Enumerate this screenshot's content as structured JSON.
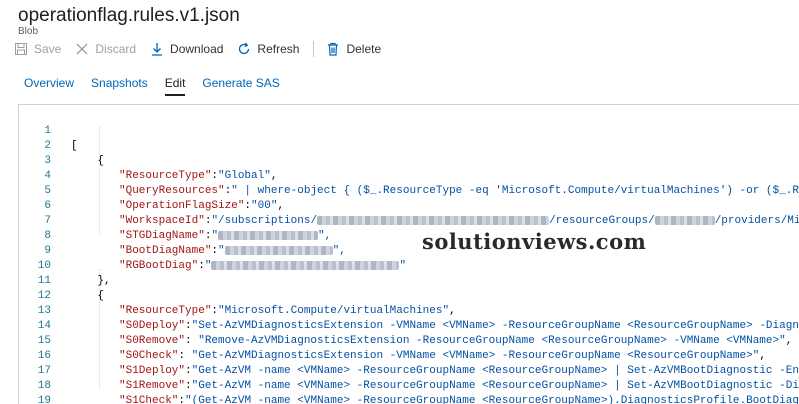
{
  "header": {
    "title": "operationflag.rules.v1.json",
    "subtitle": "Blob"
  },
  "toolbar": {
    "save_label": "Save",
    "discard_label": "Discard",
    "download_label": "Download",
    "refresh_label": "Refresh",
    "delete_label": "Delete"
  },
  "tabs": [
    {
      "label": "Overview"
    },
    {
      "label": "Snapshots"
    },
    {
      "label": "Edit"
    },
    {
      "label": "Generate SAS"
    }
  ],
  "editor": {
    "lines": [
      {
        "num": "1",
        "text": "["
      },
      {
        "num": "2",
        "text": "    {"
      },
      {
        "num": "3",
        "key": "\"ResourceType\"",
        "sep": ":",
        "val": "\"Global\"",
        "tail": ","
      },
      {
        "num": "4",
        "key": "\"QueryResources\"",
        "sep": ":",
        "val": "\" | where-object { ($_.ResourceType -eq 'Microsoft.Compute/virtualMachines') -or ($_.Resourc"
      },
      {
        "num": "5",
        "key": "\"OperationFlagSize\"",
        "sep": ":",
        "val": "\"00\"",
        "tail": ","
      },
      {
        "num": "6",
        "key": "\"WorkspaceId\"",
        "sep": ":",
        "val": "\"/subscriptions/",
        "val2": "/resourceGroups/",
        "val3": "/providers/Microso"
      },
      {
        "num": "7",
        "key": "\"STGDiagName\"",
        "sep": ":",
        "val": "\"",
        "tail": "\","
      },
      {
        "num": "8",
        "key": "\"BootDiagName\"",
        "sep": ":",
        "val": "\"",
        "tail": "\","
      },
      {
        "num": "9",
        "key": "\"RGBootDiag\"",
        "sep": ":",
        "val": "\"",
        "tail": "\""
      },
      {
        "num": "10",
        "text": "    },"
      },
      {
        "num": "11",
        "text": "    {"
      },
      {
        "num": "12",
        "key": "\"ResourceType\"",
        "sep": ":",
        "val": "\"Microsoft.Compute/virtualMachines\"",
        "tail": ","
      },
      {
        "num": "13",
        "key": "\"S0Deploy\"",
        "sep": ":",
        "val": "\"Set-AzVMDiagnosticsExtension -VMName <VMName> -ResourceGroupName <ResourceGroupName> -Diagnostics"
      },
      {
        "num": "14",
        "key": "\"S0Remove\"",
        "sep": ": ",
        "val": "\"Remove-AzVMDiagnosticsExtension -ResourceGroupName <ResourceGroupName> -VMName <VMName>\"",
        "tail": ","
      },
      {
        "num": "15",
        "key": "\"S0Check\"",
        "sep": ": ",
        "val": "\"Get-AzVMDiagnosticsExtension -VMName <VMName> -ResourceGroupName <ResourceGroupName>\"",
        "tail": ","
      },
      {
        "num": "16",
        "key": "\"S1Deploy\"",
        "sep": ":",
        "val": "\"Get-AzVM -name <VMName> -ResourceGroupName <ResourceGroupName> | Set-AzVMBootDiagnostic -Enable -"
      },
      {
        "num": "17",
        "key": "\"S1Remove\"",
        "sep": ":",
        "val": "\"Get-AzVM -name <VMName> -ResourceGroupName <ResourceGroupName> | Set-AzVMBootDiagnostic -Disable"
      },
      {
        "num": "18",
        "key": "\"S1Check\"",
        "sep": ":",
        "val": "\"(Get-AzVM -name <VMName> -ResourceGroupName <ResourceGroupName>).DiagnosticsProfile.BootDiagnostic"
      },
      {
        "num": "19",
        "text": "    },"
      }
    ]
  },
  "watermark": "solutionviews.com",
  "colors": {
    "link": "#0066b8",
    "key": "#a31515",
    "string": "#0451a5",
    "line_number": "#237893"
  }
}
